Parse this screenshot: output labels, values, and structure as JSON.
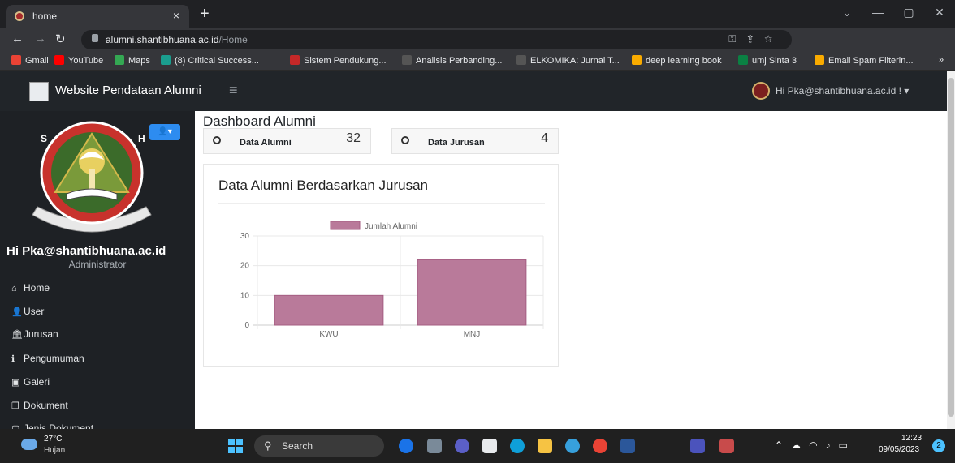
{
  "browser": {
    "tab_title": "home",
    "tab_close": "×",
    "new_tab": "+",
    "url_host": "alumni.shantibhuana.ac.id",
    "url_path": "/Home",
    "window_controls": [
      "⌄",
      "—",
      "▢",
      "✕"
    ],
    "bookmarks": [
      {
        "label": "Gmail",
        "icon_color": "#ea4335"
      },
      {
        "label": "YouTube",
        "icon_color": "#ff0000"
      },
      {
        "label": "Maps",
        "icon_color": "#34a853"
      },
      {
        "label": "(8) Critical Success...",
        "icon_color": "#1a9e8f"
      },
      {
        "label": "Sistem Pendukung...",
        "icon_color": "#c62828"
      },
      {
        "label": "Analisis Perbanding...",
        "icon_color": "#555555"
      },
      {
        "label": "ELKOMIKA: Jurnal T...",
        "icon_color": "#555555"
      },
      {
        "label": "deep learning book",
        "icon_color": "#f9ab00"
      },
      {
        "label": "umj Sinta 3",
        "icon_color": "#0b8043"
      },
      {
        "label": "Email Spam Filterin...",
        "icon_color": "#f9ab00"
      }
    ],
    "bookmarks_more": "»"
  },
  "app": {
    "title": "Website Pendataan Alumni",
    "menu_toggle": "≡",
    "user_greeting": "Hi Pka@shantibhuana.ac.id ! ▾"
  },
  "sidebar": {
    "toggle": "👤▾",
    "user": "Hi Pka@shantibhuana.ac.id",
    "role": "Administrator",
    "items": [
      {
        "label": "Home",
        "icon": "home-icon",
        "glyph": "⌂"
      },
      {
        "label": "User",
        "icon": "user-icon",
        "glyph": "👤"
      },
      {
        "label": "Jurusan",
        "icon": "building-icon",
        "glyph": "🏛"
      },
      {
        "label": "Pengumuman",
        "icon": "info-icon",
        "glyph": "ℹ"
      },
      {
        "label": "Galeri",
        "icon": "image-icon",
        "glyph": "▣"
      },
      {
        "label": "Dokument",
        "icon": "documents-icon",
        "glyph": "❐"
      },
      {
        "label": "Jenis Dokument",
        "icon": "file-icon",
        "glyph": "▢"
      }
    ]
  },
  "main": {
    "title": "Dashboard Alumni",
    "stats": [
      {
        "label": "Data Alumni",
        "value": "32"
      },
      {
        "label": "Data Jurusan",
        "value": "4"
      }
    ]
  },
  "chart_data": {
    "type": "bar",
    "title": "Data Alumni Berdasarkan Jurusan",
    "categories": [
      "KWU",
      "MNJ"
    ],
    "series": [
      {
        "name": "Jumlah Alumni",
        "values": [
          10,
          22
        ]
      }
    ],
    "ylim": [
      0,
      30
    ],
    "yticks": [
      0,
      10,
      20,
      30
    ],
    "grid": true,
    "legend": "top",
    "bar_color": "#b97a9a",
    "bar_border": "#a55d82"
  },
  "taskbar": {
    "temperature": "27°C",
    "condition": "Hujan",
    "search": "Search",
    "time": "12:23",
    "date": "09/05/2023",
    "notifications": "2"
  }
}
